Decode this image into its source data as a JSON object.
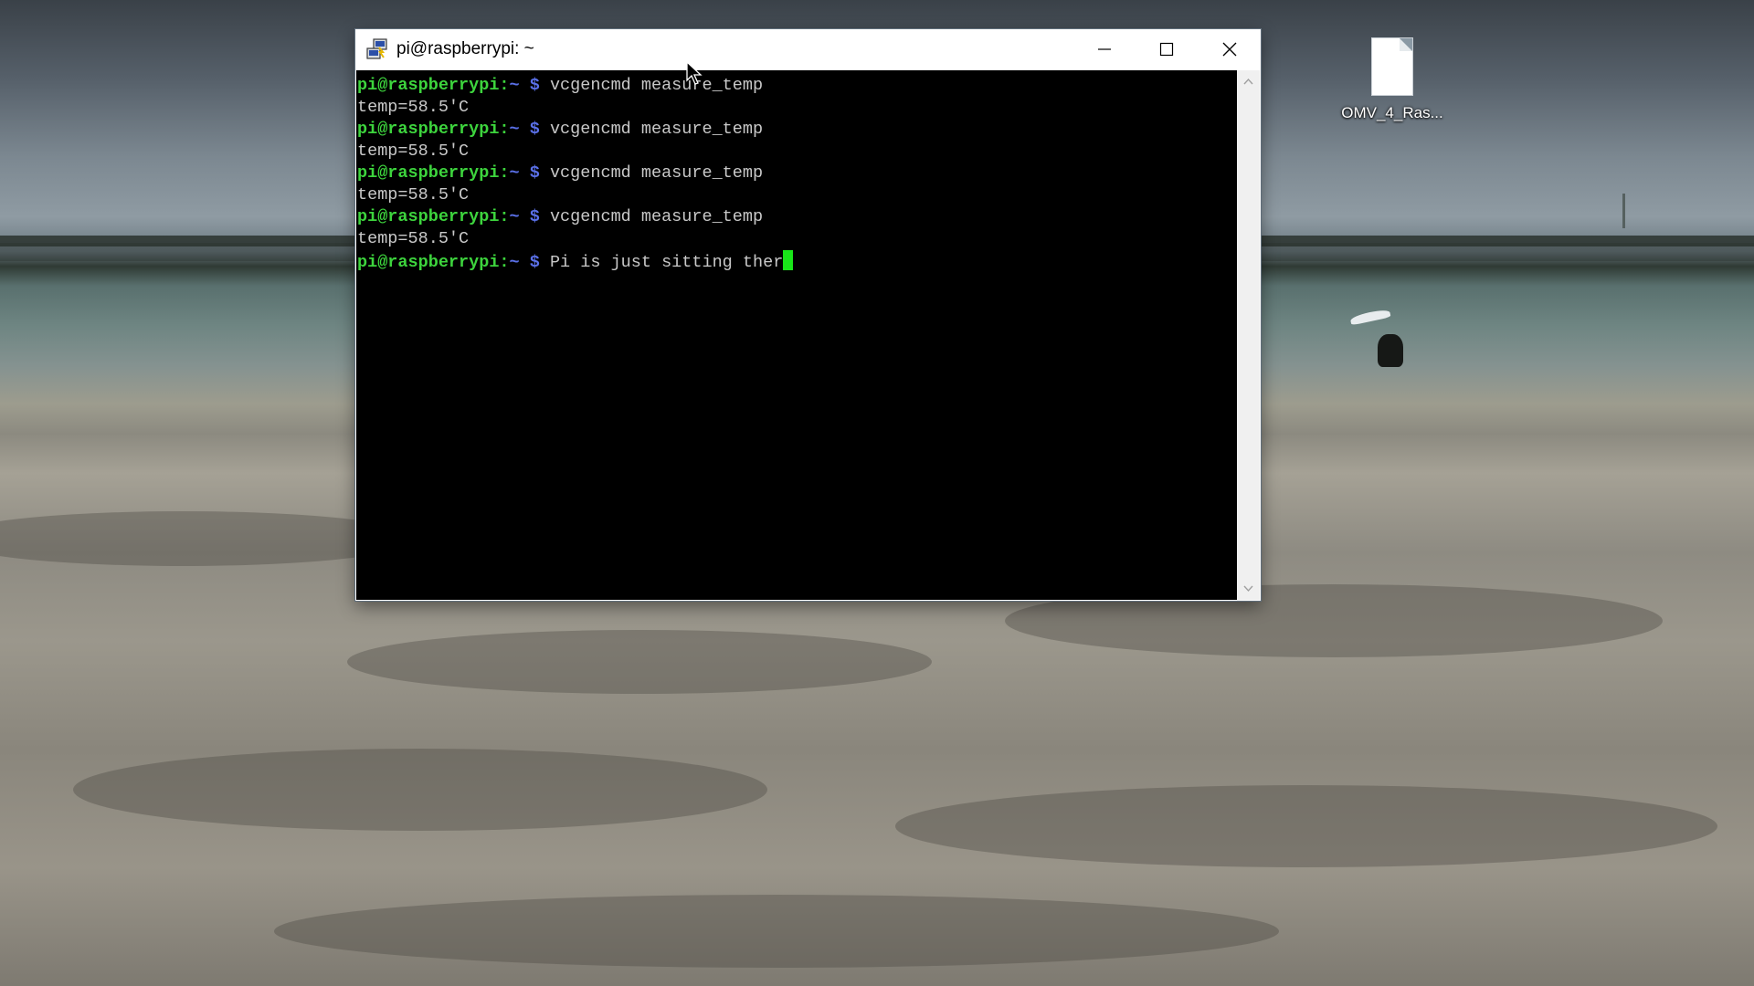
{
  "desktop": {
    "icons": [
      {
        "label": "OMV_4_Ras...",
        "icon": "file-icon"
      }
    ]
  },
  "window": {
    "title": "pi@raspberrypi: ~",
    "app_icon": "putty-icon",
    "controls": {
      "minimize": "minimize-icon",
      "maximize": "maximize-icon",
      "close": "close-icon"
    }
  },
  "terminal": {
    "prompt_user": "pi@raspberrypi:",
    "prompt_path": "~",
    "prompt_symbol": "$",
    "lines": [
      {
        "type": "command",
        "text": "vcgencmd measure_temp"
      },
      {
        "type": "output",
        "text": "temp=58.5'C"
      },
      {
        "type": "command",
        "text": "vcgencmd measure_temp"
      },
      {
        "type": "output",
        "text": "temp=58.5'C"
      },
      {
        "type": "command",
        "text": "vcgencmd measure_temp"
      },
      {
        "type": "output",
        "text": "temp=58.5'C"
      },
      {
        "type": "command",
        "text": "vcgencmd measure_temp"
      },
      {
        "type": "output",
        "text": "temp=58.5'C"
      },
      {
        "type": "command",
        "text": "Pi is just sitting ther"
      }
    ],
    "colors": {
      "background": "#000000",
      "prompt_user": "#3dd43d",
      "prompt_path": "#5a70e8",
      "text": "#c8c8c8",
      "cursor": "#19e619"
    }
  }
}
